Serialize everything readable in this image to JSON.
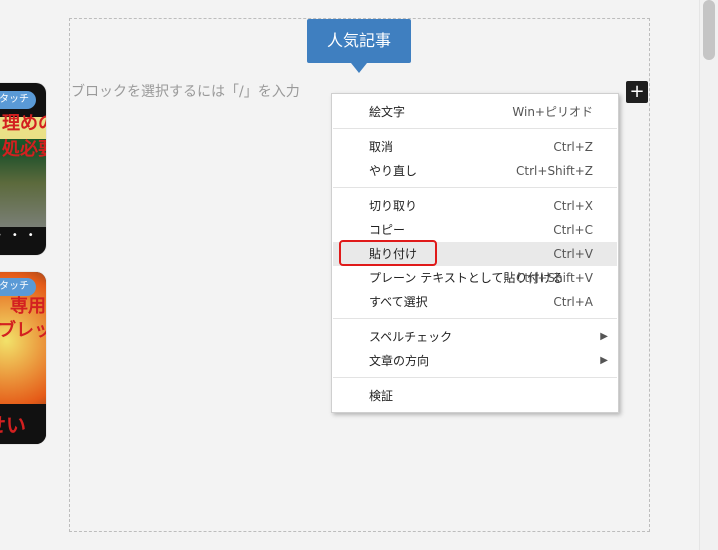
{
  "badge": {
    "text": "人気記事"
  },
  "editor": {
    "placeholder": "ブロックを選択するには「/」を入力"
  },
  "left_previews": [
    {
      "pill": "タッチ",
      "lines": [
        "理めの",
        "処必要"
      ]
    },
    {
      "pill": "タッチ",
      "lines": [
        "専用",
        "ブレット"
      ],
      "bottom": "せい"
    }
  ],
  "context_menu": {
    "items": [
      {
        "label": "絵文字",
        "shortcut": "Win+ピリオド"
      },
      {
        "label": "取消",
        "shortcut": "Ctrl+Z"
      },
      {
        "label": "やり直し",
        "shortcut": "Ctrl+Shift+Z"
      },
      {
        "label": "切り取り",
        "shortcut": "Ctrl+X"
      },
      {
        "label": "コピー",
        "shortcut": "Ctrl+C"
      },
      {
        "label": "貼り付け",
        "shortcut": "Ctrl+V"
      },
      {
        "label": "プレーン テキストとして貼り付ける",
        "shortcut": "Ctrl+Shift+V"
      },
      {
        "label": "すべて選択",
        "shortcut": "Ctrl+A"
      },
      {
        "label": "スペルチェック",
        "submenu": true
      },
      {
        "label": "文章の方向",
        "submenu": true
      },
      {
        "label": "検証"
      }
    ],
    "highlighted_index": 5
  }
}
